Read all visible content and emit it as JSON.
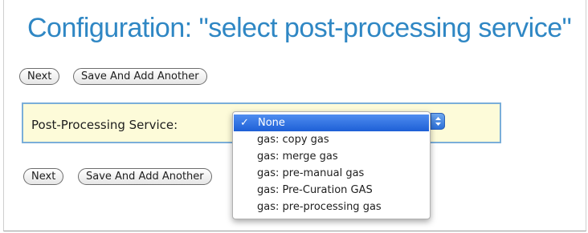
{
  "page": {
    "title": "Configuration: \"select post-processing service\""
  },
  "top_buttons": {
    "next_label": "Next",
    "save_add_label": "Save And Add Another"
  },
  "form": {
    "field_label": "Post-Processing Service:",
    "selected_value": "None",
    "options": [
      "None",
      "gas: copy gas",
      "gas: merge gas",
      "gas: pre-manual gas",
      "gas: Pre-Curation GAS",
      "gas: pre-processing gas"
    ],
    "selected_check": "✓"
  },
  "bottom_buttons": {
    "next_label": "Next",
    "save_add_label": "Save And Add Another"
  },
  "colors": {
    "title": "#2f87c4",
    "field_background": "#fdfbd9",
    "field_border": "#7aaed9",
    "menu_highlight": "#2a6ee0"
  },
  "icons": {
    "dropdown_arrows": "updown-arrows-icon",
    "check": "checkmark-icon"
  }
}
